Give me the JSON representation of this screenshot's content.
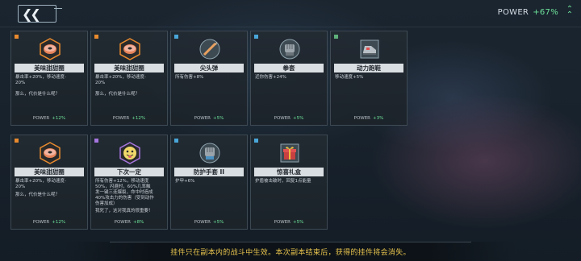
{
  "header": {
    "power_label": "POWER",
    "power_value": "+67%",
    "back_icon": "double-chevron-left-icon",
    "expand_icon": "double-chevron-up-icon"
  },
  "colors": {
    "rarity_orange": "#e88a2e",
    "rarity_blue": "#4aa6d8",
    "rarity_purple": "#a676e0",
    "rarity_green": "#5fb07a",
    "power_green": "#6ee39a",
    "hint_yellow": "#e8c44e"
  },
  "cards": [
    {
      "rarity": "orange",
      "icon": "donut-icon",
      "name": "美味甜甜圈",
      "desc": "暴击率+20%，移动速度-\n20%",
      "flavor": "那么，代价是什么呢？",
      "power_label": "POWER",
      "power_value": "+12%"
    },
    {
      "rarity": "orange",
      "icon": "donut-icon",
      "name": "美味甜甜圈",
      "desc": "暴击率+20%，移动速度-\n20%",
      "flavor": "那么，代价是什么呢？",
      "power_label": "POWER",
      "power_value": "+12%"
    },
    {
      "rarity": "blue",
      "icon": "spike-dart-icon",
      "name": "尖头弹",
      "desc": "所有伤害+8%",
      "flavor": "",
      "power_label": "POWER",
      "power_value": "+5%"
    },
    {
      "rarity": "blue",
      "icon": "fist-glove-icon",
      "name": "拳套",
      "desc": "近你伤害+24%",
      "flavor": "",
      "power_label": "POWER",
      "power_value": "+5%"
    },
    {
      "rarity": "green",
      "icon": "power-shoe-icon",
      "name": "动力跑鞋",
      "desc": "移动速度+5%",
      "flavor": "",
      "power_label": "POWER",
      "power_value": "+3%"
    },
    {
      "rarity": "orange",
      "icon": "donut-icon",
      "name": "美味甜甜圈",
      "desc": "暴击率+20%，移动速度-\n20%",
      "flavor": "那么，代价是什么呢？",
      "power_label": "POWER",
      "power_value": "+12%"
    },
    {
      "rarity": "purple",
      "icon": "tongue-face-icon",
      "name": "下次一定",
      "desc": "所有伤害+12%，移动速度\n50%，闪避时，60%几率触\n发一键三连爆裂，命中时造成\n40%攻击力的伤害（受到动作\n伤害加成）",
      "flavor": "我死了，这对我真的很重要！",
      "power_label": "POWER",
      "power_value": "+8%"
    },
    {
      "rarity": "blue",
      "icon": "armored-glove-icon",
      "name": "防护手套 II",
      "desc": "护甲+6%",
      "flavor": "",
      "power_label": "POWER",
      "power_value": "+5%"
    },
    {
      "rarity": "blue",
      "icon": "gift-box-icon",
      "name": "惊喜礼盒",
      "desc": "护盾被击破时，回复1点能量",
      "flavor": "",
      "power_label": "POWER",
      "power_value": "+5%"
    }
  ],
  "hint": "挂件只在副本内的战斗中生效。本次副本结束后，获得的挂件将会消失。"
}
